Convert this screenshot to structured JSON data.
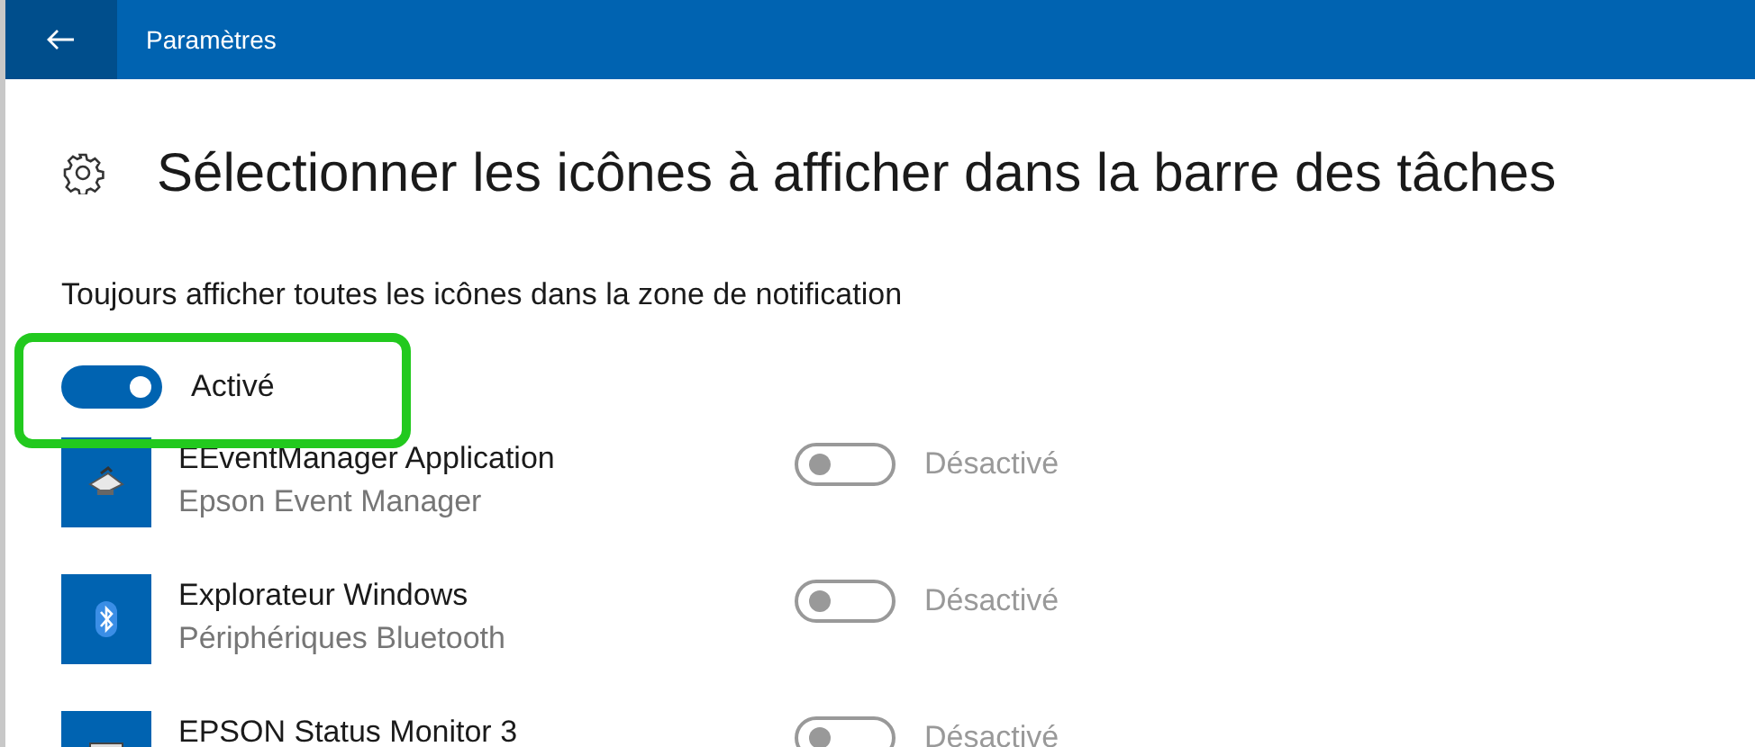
{
  "window": {
    "title": "Paramètres"
  },
  "heading": "Sélectionner les icônes à afficher dans la barre des tâches",
  "always_show": {
    "label": "Toujours afficher toutes les icônes dans la zone de notification",
    "on": true,
    "state_text": "Activé",
    "highlighted": true
  },
  "apps": [
    {
      "kind": "printer",
      "name": "EEventManager Application",
      "description": "Epson Event Manager",
      "on": false,
      "disabled": true,
      "state_text": "Désactivé"
    },
    {
      "kind": "bluetooth",
      "name": "Explorateur Windows",
      "description": "Périphériques Bluetooth",
      "on": false,
      "disabled": true,
      "state_text": "Désactivé"
    },
    {
      "kind": "monitor",
      "name": "EPSON Status Monitor 3",
      "on": false,
      "disabled": true,
      "state_text": "Désactivé"
    }
  ]
}
